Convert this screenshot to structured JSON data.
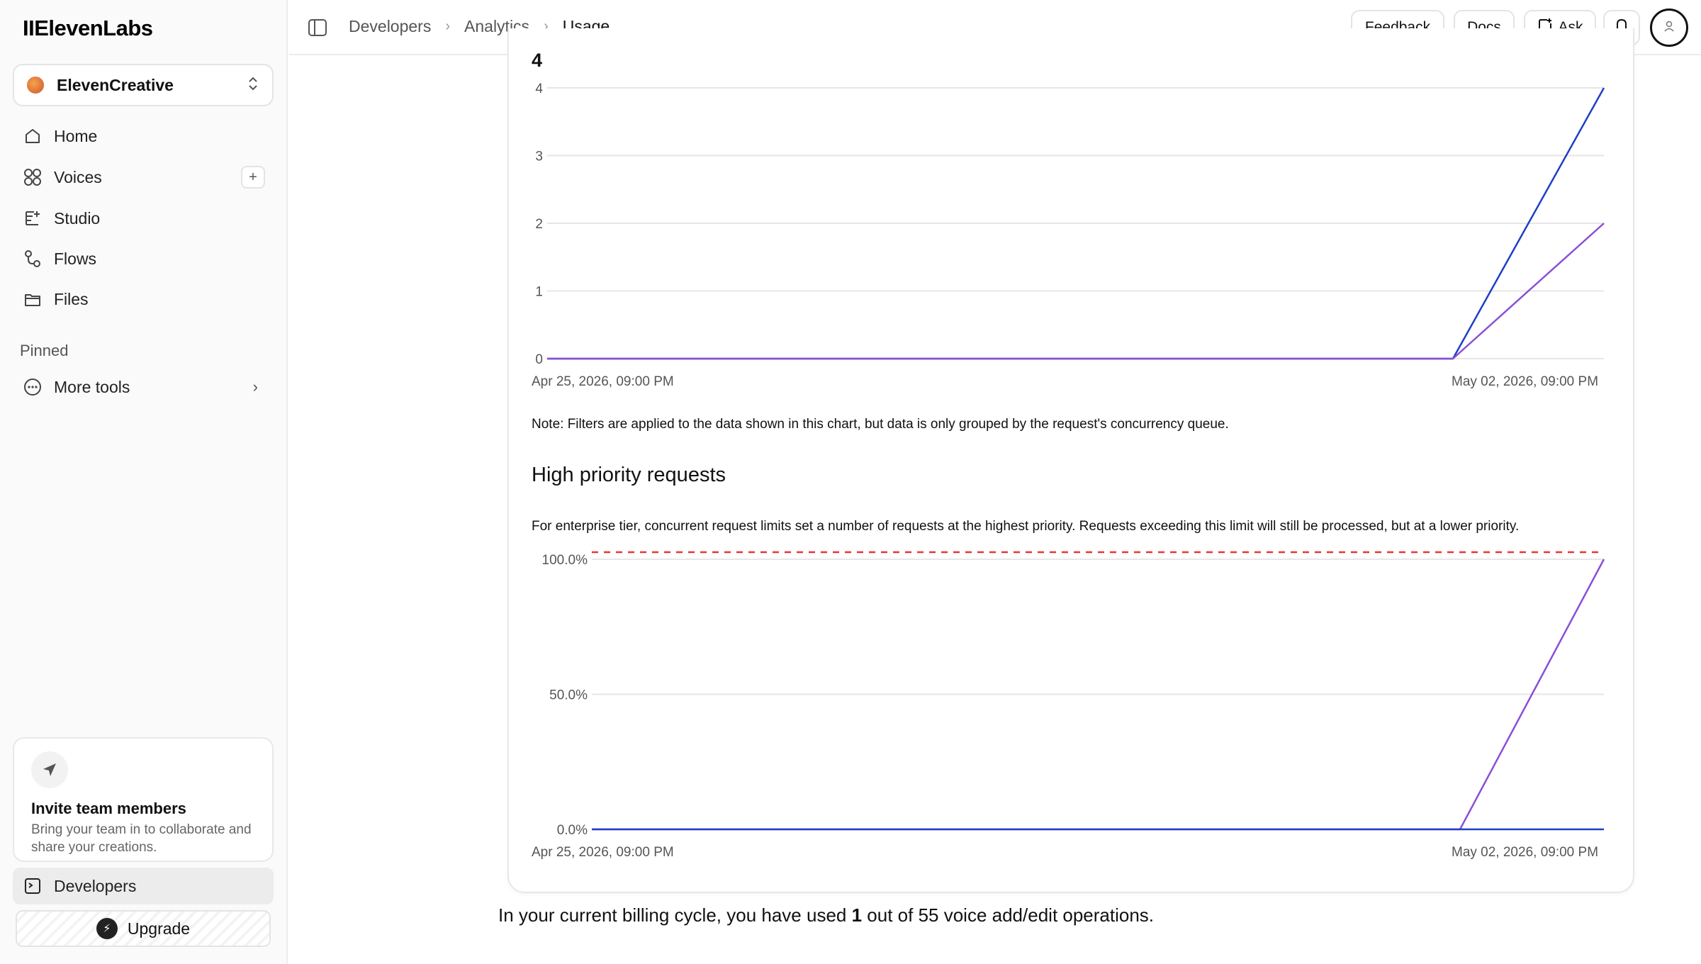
{
  "app": {
    "logo": "IIElevenLabs"
  },
  "workspace": {
    "name": "ElevenCreative"
  },
  "sidebar": {
    "items": [
      {
        "label": "Home",
        "icon": "home-icon"
      },
      {
        "label": "Voices",
        "icon": "voices-icon"
      },
      {
        "label": "Studio",
        "icon": "studio-icon"
      },
      {
        "label": "Flows",
        "icon": "flows-icon"
      },
      {
        "label": "Files",
        "icon": "files-icon"
      }
    ],
    "pinned_title": "Pinned",
    "more_tools": "More tools",
    "invite": {
      "title": "Invite team members",
      "text": "Bring your team in to collaborate and share your creations."
    },
    "developers": "Developers",
    "upgrade": "Upgrade"
  },
  "header": {
    "breadcrumbs": [
      "Developers",
      "Analytics",
      "Usage"
    ],
    "feedback": "Feedback",
    "docs": "Docs",
    "ask": "Ask"
  },
  "main": {
    "metric_value": "4",
    "note": "Note: Filters are applied to the data shown in this chart, but data is only grouped by the request's concurrency queue.",
    "high_priority_title": "High priority requests",
    "high_priority_desc": "For enterprise tier, concurrent request limits set a number of requests at the highest priority. Requests exceeding this limit will still be processed, but at a lower priority.",
    "billing_prefix": "In your current billing cycle, you have used ",
    "billing_used": "1",
    "billing_suffix": " out of 55 voice add/edit operations."
  },
  "chart_data": [
    {
      "type": "line",
      "x": [
        "Apr 25, 2026, 09:00 PM",
        "May 01, 2026, 09:00 PM",
        "May 02, 2026, 09:00 PM"
      ],
      "x_tick_labels": [
        "Apr 25, 2026, 09:00 PM",
        "May 02, 2026, 09:00 PM"
      ],
      "ylim": [
        0,
        4
      ],
      "y_ticks": [
        "0",
        "1",
        "2",
        "3",
        "4"
      ],
      "grid": true,
      "series": [
        {
          "values": [
            0,
            0,
            4
          ],
          "color": "#1f3fc4"
        },
        {
          "values": [
            0,
            0,
            2
          ],
          "color": "#8a4fd6"
        }
      ]
    },
    {
      "type": "line",
      "x": [
        "Apr 25, 2026, 09:00 PM",
        "May 01, 2026, 09:00 PM",
        "May 02, 2026, 09:00 PM"
      ],
      "x_tick_labels": [
        "Apr 25, 2026, 09:00 PM",
        "May 02, 2026, 09:00 PM"
      ],
      "ylim": [
        0,
        100
      ],
      "y_ticks": [
        "0.0%",
        "50.0%",
        "100.0%"
      ],
      "grid": true,
      "threshold": {
        "value": 100,
        "color": "#e53935"
      },
      "series": [
        {
          "values": [
            0,
            0,
            100
          ],
          "color": "#8a4fd6"
        },
        {
          "values": [
            0,
            0,
            0
          ],
          "color": "#1f3fc4"
        }
      ]
    }
  ]
}
